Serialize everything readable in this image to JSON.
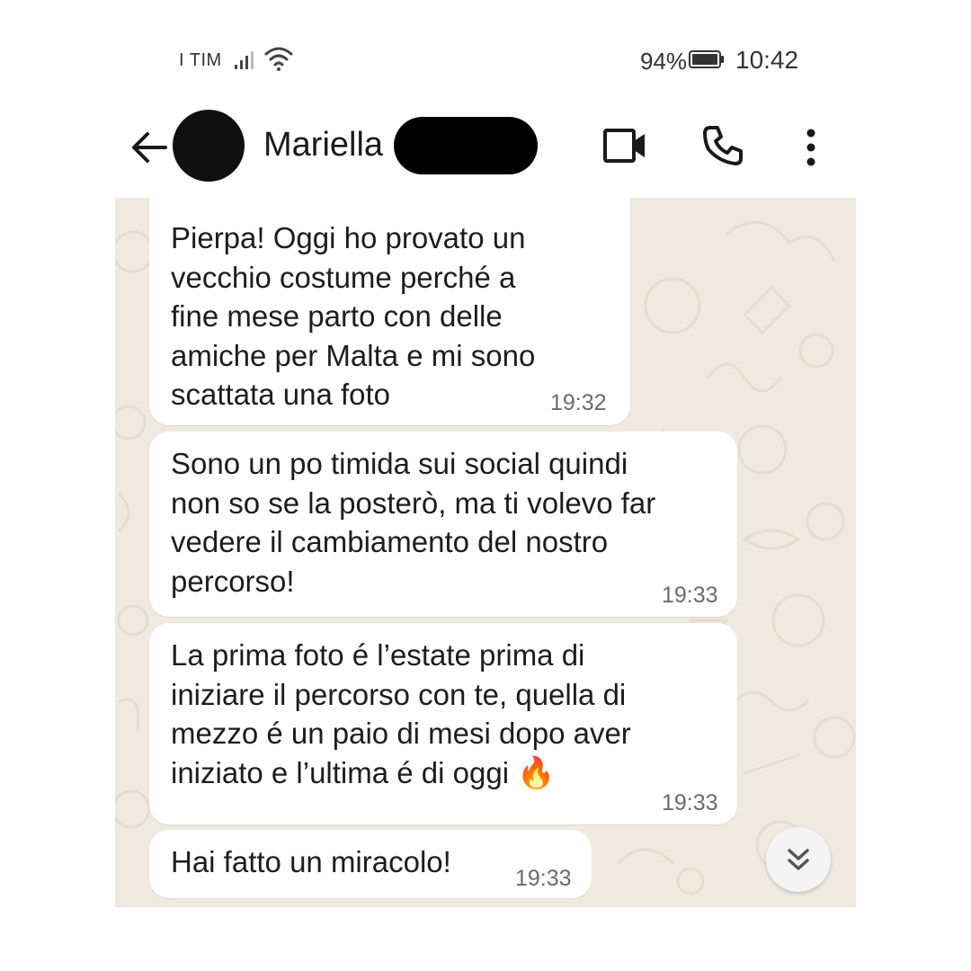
{
  "status_bar": {
    "carrier": "I TIM",
    "battery": "94%",
    "time": "10:42"
  },
  "header": {
    "contact_name": "Mariella",
    "icons": [
      "back-arrow-icon",
      "video-call-icon",
      "phone-call-icon",
      "more-vert-icon"
    ]
  },
  "messages": [
    {
      "text": "Pierpa! Oggi ho provato un\nvecchio costume perché a\nfine mese parto con delle\namiche per Malta e mi sono\nscattata una foto",
      "time": "19:32"
    },
    {
      "text": "Sono un po timida sui social quindi\nnon so se la posterò, ma ti volevo far\nvedere il cambiamento del nostro\npercorso!",
      "time": "19:33"
    },
    {
      "text": "La prima foto é l’estate prima di\niniziare il percorso con te, quella di\nmezzo é un paio di mesi dopo aver\niniziato e l’ultima é di oggi ",
      "emoji": "🔥",
      "time": "19:33"
    },
    {
      "text": "Hai fatto un miracolo!",
      "time": "19:33"
    }
  ],
  "colors": {
    "chat_background": "#efe9df",
    "bubble": "#ffffff",
    "timestamp": "#6b6b6b"
  }
}
